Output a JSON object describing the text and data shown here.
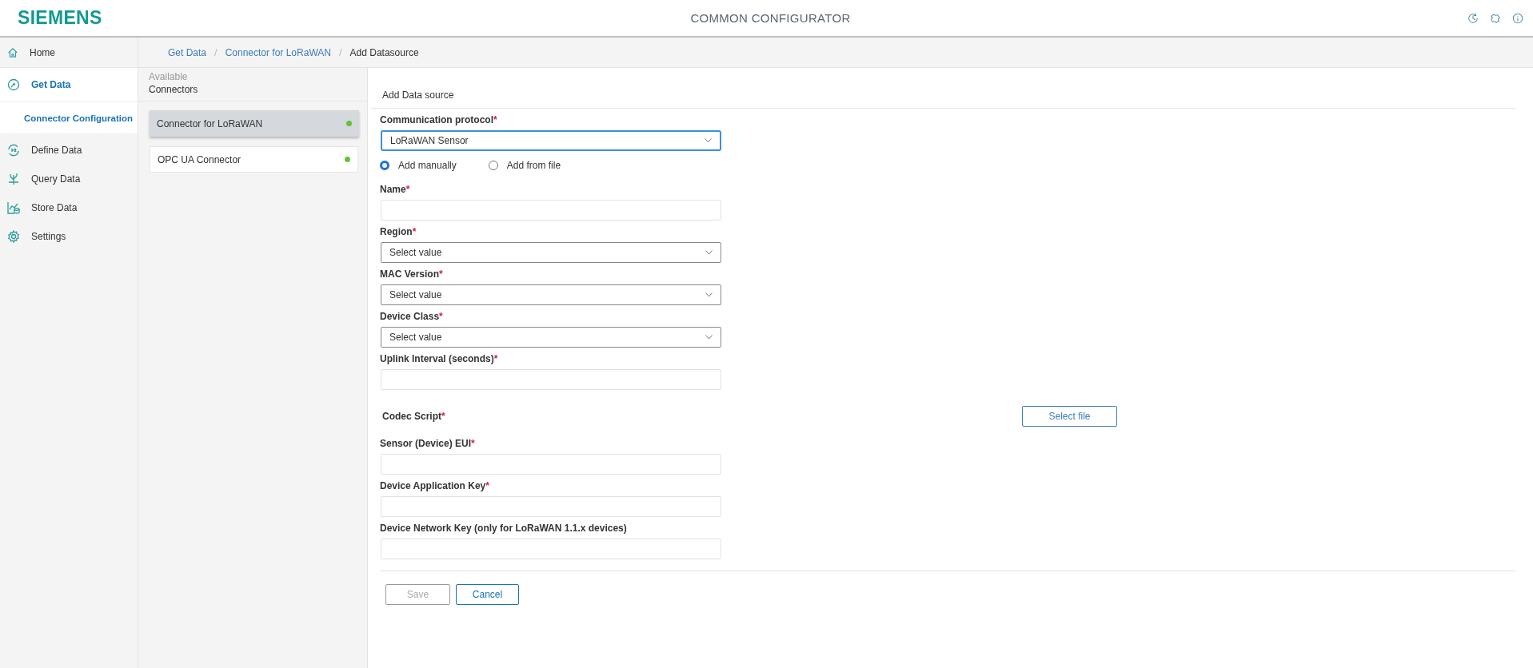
{
  "header": {
    "logo": "SIEMENS",
    "title": "COMMON CONFIGURATOR"
  },
  "sidebar": {
    "items": [
      {
        "label": "Home",
        "selected": false
      },
      {
        "label": "Get Data",
        "selected": true,
        "children": [
          {
            "label": "Connector Configuration",
            "selected": true
          }
        ]
      },
      {
        "label": "Define Data",
        "selected": false
      },
      {
        "label": "Query Data",
        "selected": false
      },
      {
        "label": "Store Data",
        "selected": false
      },
      {
        "label": "Settings",
        "selected": false
      }
    ]
  },
  "breadcrumb": [
    {
      "label": "Get Data",
      "kind": "link"
    },
    {
      "separator": "/",
      "label": "Connector for LoRaWAN",
      "kind": "link"
    },
    {
      "separator": "/",
      "label": "Add Datasource",
      "kind": "current"
    }
  ],
  "connectors": {
    "caption": "Available",
    "title": "Connectors",
    "items": [
      {
        "label": "Connector for LoRaWAN",
        "selected": true,
        "color": "#65c03a"
      },
      {
        "label": "OPC UA Connector",
        "selected": false,
        "color": "#65c03a"
      }
    ]
  },
  "form": {
    "title": "Add Data source",
    "fields": [
      {
        "kind": "select",
        "label": "Communication protocol",
        "required_mark": "*",
        "value": "LoRaWAN Sensor",
        "focused": true
      },
      {
        "kind": "radios",
        "options": [
          {
            "label": "Add manually",
            "selected": true
          },
          {
            "label": "Add from file",
            "selected": false
          }
        ]
      },
      {
        "kind": "input",
        "label": "Name",
        "required_mark": "*"
      },
      {
        "kind": "select",
        "label": "Region",
        "required_mark": "*",
        "placeholder": "Select value",
        "focused": false
      },
      {
        "kind": "select",
        "label": "MAC Version",
        "required_mark": "*",
        "placeholder": "Select value",
        "focused": false
      },
      {
        "kind": "select",
        "label": "Device Class",
        "required_mark": "*",
        "placeholder": "Select value",
        "focused": false
      },
      {
        "kind": "input",
        "label": "Uplink Interval (seconds)",
        "required_mark": "*"
      },
      {
        "kind": "file",
        "label": "Codec Script",
        "required_mark": "*",
        "button": "Select file"
      },
      {
        "kind": "input",
        "label": "Sensor (Device) EUI",
        "required_mark": "*"
      },
      {
        "kind": "input",
        "label": "Device Application Key",
        "required_mark": "*"
      },
      {
        "kind": "input",
        "label": "Device Network Key (only for LoRaWAN 1.1.x devices)"
      }
    ],
    "buttons": [
      {
        "label": "Save",
        "disabled": true
      },
      {
        "label": "Cancel",
        "disabled": false
      }
    ]
  }
}
